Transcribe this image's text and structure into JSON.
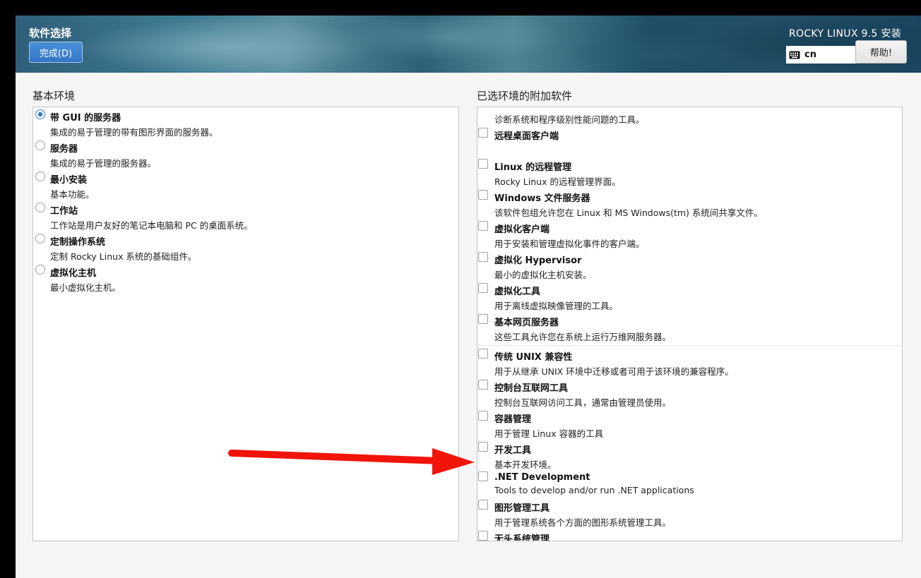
{
  "header": {
    "title": "软件选择",
    "done_label": "完成(D)",
    "product": "ROCKY LINUX 9.5 安装",
    "keyboard_layout": "cn",
    "help_label": "帮助!"
  },
  "base_env": {
    "title": "基本环境",
    "selected_index": 0,
    "items": [
      {
        "name": "带 GUI 的服务器",
        "desc": "集成的易于管理的带有图形界面的服务器。"
      },
      {
        "name": "服务器",
        "desc": "集成的易于管理的服务器。"
      },
      {
        "name": "最小安装",
        "desc": "基本功能。"
      },
      {
        "name": "工作站",
        "desc": "工作站是用户友好的笔记本电脑和 PC 的桌面系统。"
      },
      {
        "name": "定制操作系统",
        "desc": "定制 Rocky Linux 系统的基础组件。"
      },
      {
        "name": "虚拟化主机",
        "desc": "最小虚拟化主机。"
      }
    ]
  },
  "addons": {
    "title": "已选环境的附加软件",
    "partial_top_desc": "诊断系统和程序级别性能问题的工具。",
    "items": [
      {
        "name": "远程桌面客户端",
        "desc": ""
      },
      {
        "name": "Linux 的远程管理",
        "desc": "Rocky Linux 的远程管理界面。"
      },
      {
        "name": "Windows 文件服务器",
        "desc": "该软件包组允许您在 Linux 和 MS Windows(tm) 系统间共享文件。"
      },
      {
        "name": "虚拟化客户端",
        "desc": "用于安装和管理虚拟化事件的客户端。"
      },
      {
        "name": "虚拟化 Hypervisor",
        "desc": "最小的虚拟化主机安装。"
      },
      {
        "name": "虚拟化工具",
        "desc": "用于离线虚拟映像管理的工具。"
      },
      {
        "name": "基本网页服务器",
        "desc": "这些工具允许您在系统上运行万维网服务器。"
      },
      {
        "name": "传统 UNIX 兼容性",
        "desc": "用于从继承 UNIX 环境中迁移或者可用于该环境的兼容程序。"
      },
      {
        "name": "控制台互联网工具",
        "desc": "控制台互联网访问工具，通常由管理员使用。"
      },
      {
        "name": "容器管理",
        "desc": "用于管理 Linux 容器的工具"
      },
      {
        "name": "开发工具",
        "desc": "基本开发环境。"
      },
      {
        "name": ".NET Development",
        "desc": "Tools to develop and/or run .NET applications"
      },
      {
        "name": "图形管理工具",
        "desc": "用于管理系统各个方面的图形系统管理工具。"
      },
      {
        "name": "无头系统管理",
        "desc": ""
      }
    ]
  },
  "colors": {
    "accent": "#3d7fca",
    "annotation_arrow": "#f0140a"
  }
}
